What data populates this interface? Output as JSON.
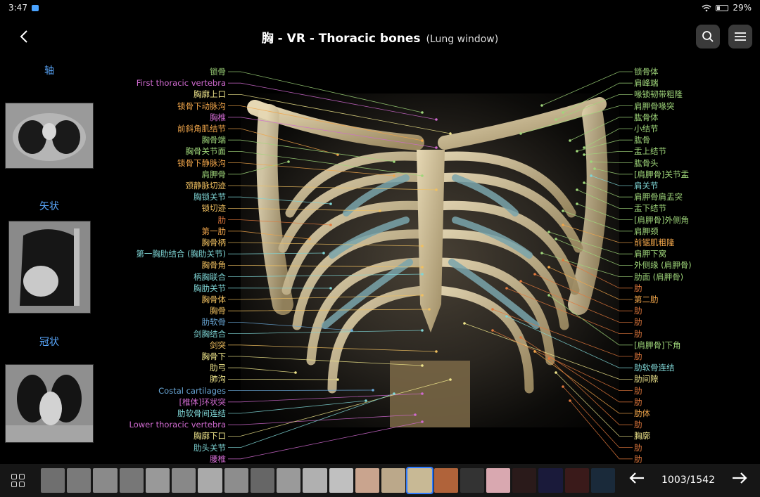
{
  "status": {
    "time": "3:47",
    "battery": "29%"
  },
  "header": {
    "back_icon": "arrow-left-icon",
    "title": "胸 - VR - Thoracic bones",
    "window": "(Lung window)",
    "search_icon": "search-icon",
    "menu_icon": "hamburger-icon"
  },
  "side_views": [
    {
      "label": "轴"
    },
    {
      "label": "矢状"
    },
    {
      "label": "冠状"
    }
  ],
  "left_labels": [
    {
      "text": "锁骨",
      "color": "#9fd67a"
    },
    {
      "text": "First thoracic vertebra",
      "color": "#d06ad0"
    },
    {
      "text": "胸廓上口",
      "color": "#f0e68c"
    },
    {
      "text": "锁骨下动脉沟",
      "color": "#f0a54a"
    },
    {
      "text": "胸椎",
      "color": "#d06ad0"
    },
    {
      "text": "前斜角肌结节",
      "color": "#f0a54a"
    },
    {
      "text": "胸骨端",
      "color": "#9fd67a"
    },
    {
      "text": "胸骨关节面",
      "color": "#9fd67a"
    },
    {
      "text": "锁骨下静脉沟",
      "color": "#f0a54a"
    },
    {
      "text": "肩胛骨",
      "color": "#9fd67a"
    },
    {
      "text": "颈静脉切迹",
      "color": "#f0c060"
    },
    {
      "text": "胸锁关节",
      "color": "#7fd6d6"
    },
    {
      "text": "锁切迹",
      "color": "#f0c060"
    },
    {
      "text": "肋",
      "color": "#e0783c"
    },
    {
      "text": "第一肋",
      "color": "#f0a54a"
    },
    {
      "text": "胸骨柄",
      "color": "#f0c060"
    },
    {
      "text": "第一胸肋结合 (胸肋关节)",
      "color": "#7fd6d6"
    },
    {
      "text": "胸骨角",
      "color": "#f0c060"
    },
    {
      "text": "柄胸联合",
      "color": "#7fd6d6"
    },
    {
      "text": "胸肋关节",
      "color": "#7fd6d6"
    },
    {
      "text": "胸骨体",
      "color": "#f0c060"
    },
    {
      "text": "胸骨",
      "color": "#f0c060"
    },
    {
      "text": "肋软骨",
      "color": "#6aa8d8"
    },
    {
      "text": "剑胸结合",
      "color": "#7fd6d6"
    },
    {
      "text": "剑突",
      "color": "#f0c060"
    },
    {
      "text": "胸骨下",
      "color": "#f0e68c"
    },
    {
      "text": "肋弓",
      "color": "#f0e68c"
    },
    {
      "text": "肺沟",
      "color": "#f0e68c"
    },
    {
      "text": "Costal cartilages",
      "color": "#6aa8d8"
    },
    {
      "text": "[椎体]环状突",
      "color": "#d06ad0"
    },
    {
      "text": "肋软骨间连结",
      "color": "#7fd6d6"
    },
    {
      "text": "Lower thoracic vertebra",
      "color": "#d06ad0"
    },
    {
      "text": "胸廓下口",
      "color": "#f0e68c"
    },
    {
      "text": "肋头关节",
      "color": "#7fd6d6"
    },
    {
      "text": "腰椎",
      "color": "#d06ad0"
    }
  ],
  "right_labels": [
    {
      "text": "锁骨体",
      "color": "#9fd67a"
    },
    {
      "text": "肩峰端",
      "color": "#9fd67a"
    },
    {
      "text": "喙锁韧带粗隆",
      "color": "#9fd67a"
    },
    {
      "text": "肩胛骨喙突",
      "color": "#9fd67a"
    },
    {
      "text": "肱骨体",
      "color": "#9fd67a"
    },
    {
      "text": "小结节",
      "color": "#9fd67a"
    },
    {
      "text": "肱骨",
      "color": "#9fd67a"
    },
    {
      "text": "盂上结节",
      "color": "#9fd67a"
    },
    {
      "text": "肱骨头",
      "color": "#9fd67a"
    },
    {
      "text": "[肩胛骨]关节盂",
      "color": "#9fd67a"
    },
    {
      "text": "肩关节",
      "color": "#7fd6d6"
    },
    {
      "text": "肩胛骨肩盂突",
      "color": "#9fd67a"
    },
    {
      "text": "盂下结节",
      "color": "#9fd67a"
    },
    {
      "text": "[肩胛骨]外侧角",
      "color": "#9fd67a"
    },
    {
      "text": "肩胛颈",
      "color": "#9fd67a"
    },
    {
      "text": "前锯肌粗隆",
      "color": "#f0a54a"
    },
    {
      "text": "肩胛下窝",
      "color": "#9fd67a"
    },
    {
      "text": "外侧缘 (肩胛骨)",
      "color": "#9fd67a"
    },
    {
      "text": "肋面 (肩胛骨)",
      "color": "#9fd67a"
    },
    {
      "text": "肋",
      "color": "#e0783c"
    },
    {
      "text": "第二肋",
      "color": "#f0a54a"
    },
    {
      "text": "肋",
      "color": "#e0783c"
    },
    {
      "text": "肋",
      "color": "#e0783c"
    },
    {
      "text": "肋",
      "color": "#e0783c"
    },
    {
      "text": "[肩胛骨]下角",
      "color": "#9fd67a"
    },
    {
      "text": "肋",
      "color": "#e0783c"
    },
    {
      "text": "肋软骨连结",
      "color": "#7fd6d6"
    },
    {
      "text": "肋间隙",
      "color": "#f0e68c"
    },
    {
      "text": "肋",
      "color": "#e0783c"
    },
    {
      "text": "肋",
      "color": "#e0783c"
    },
    {
      "text": "肋体",
      "color": "#f0a54a"
    },
    {
      "text": "肋",
      "color": "#e0783c"
    },
    {
      "text": "胸廓",
      "color": "#f0e68c"
    },
    {
      "text": "肋",
      "color": "#e0783c"
    },
    {
      "text": "肋",
      "color": "#e0783c"
    }
  ],
  "bottom_bar": {
    "grid_icon": "grid-icon",
    "prev_icon": "arrow-left-icon",
    "next_icon": "arrow-right-icon",
    "page_counter": "1003/1542",
    "selected_index": 14
  }
}
